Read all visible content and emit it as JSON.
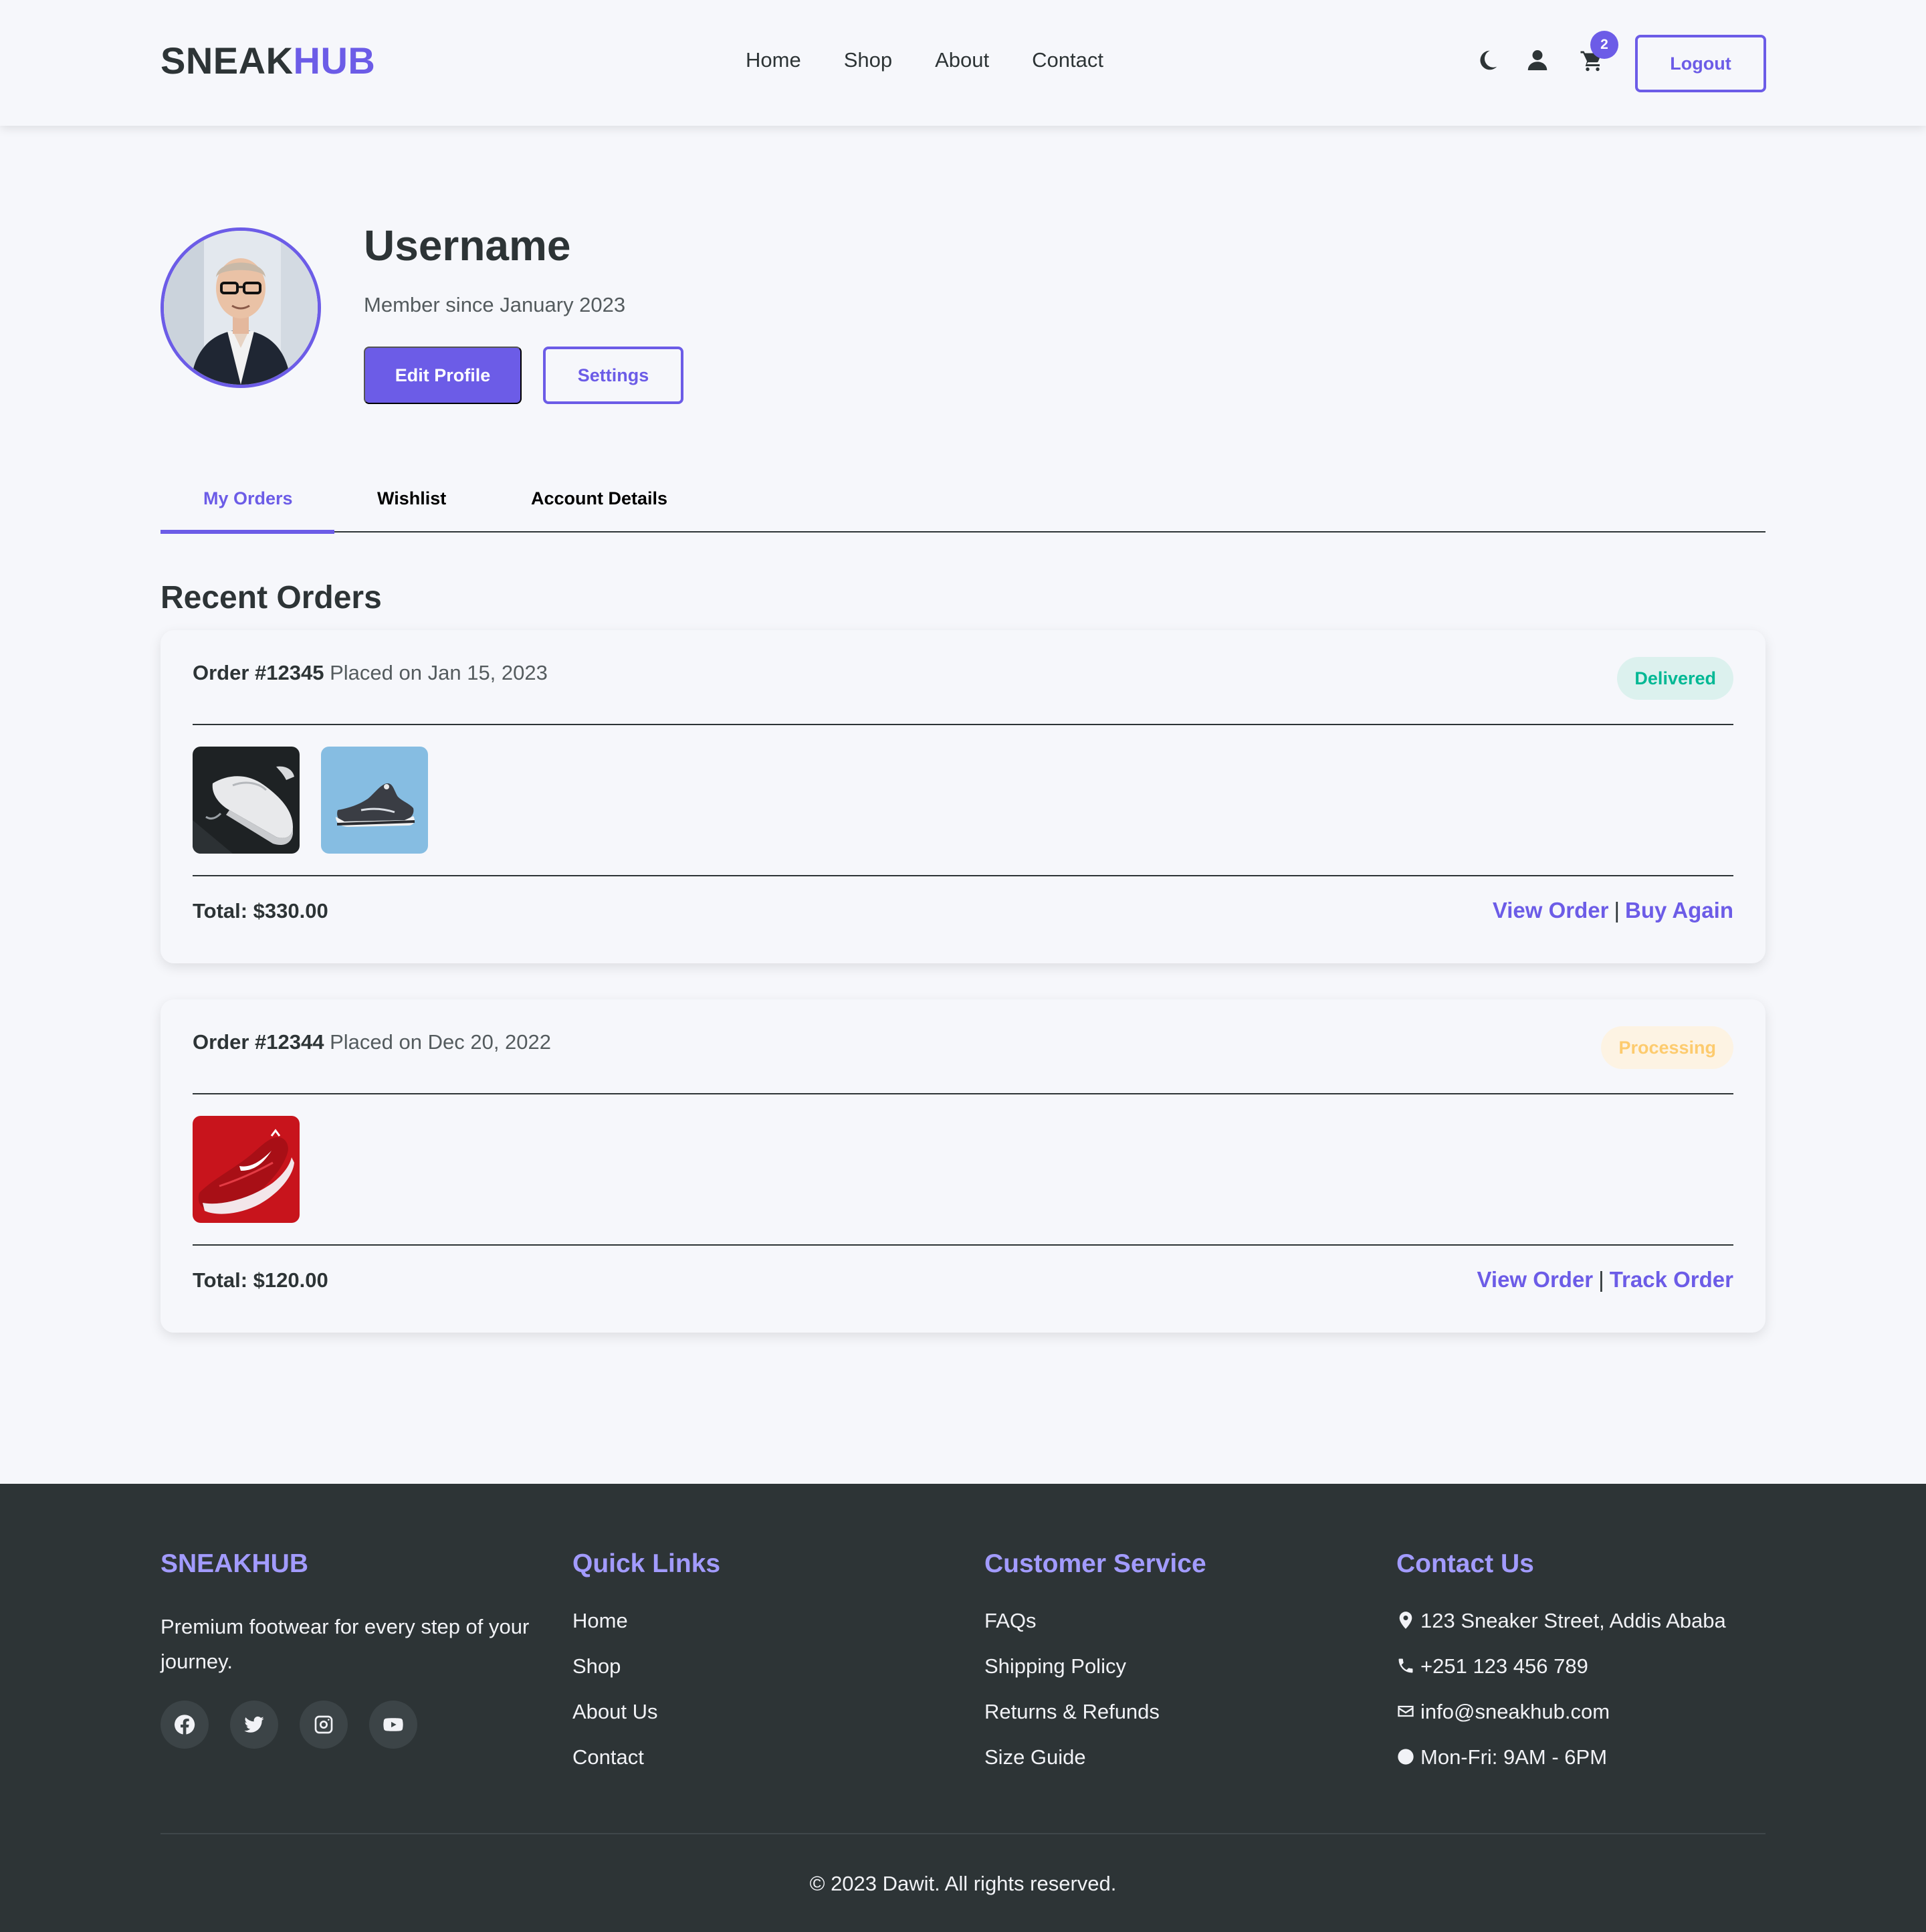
{
  "header": {
    "logo_part1": "SNEAK",
    "logo_part2": "HUB",
    "nav": [
      "Home",
      "Shop",
      "About",
      "Contact"
    ],
    "icons": [
      "moon-icon",
      "user-icon",
      "cart-icon"
    ],
    "cart_count": "2",
    "logout_label": "Logout"
  },
  "profile": {
    "username": "Username",
    "member_since": "Member since January 2023",
    "edit_label": "Edit Profile",
    "settings_label": "Settings"
  },
  "tabs": [
    {
      "label": "My Orders",
      "active": true
    },
    {
      "label": "Wishlist",
      "active": false
    },
    {
      "label": "Account Details",
      "active": false
    }
  ],
  "orders": {
    "title": "Recent Orders",
    "items": [
      {
        "number": "Order #12345",
        "placed": "Placed on Jan 15, 2023",
        "status": "Delivered",
        "total": "Total: $330.00",
        "action1": "View Order",
        "separator": "|",
        "action2": "Buy Again",
        "products": [
          "white-sneaker",
          "black-sneaker-on-blue"
        ]
      },
      {
        "number": "Order #12344",
        "placed": "Placed on Dec 20, 2022",
        "status": "Processing",
        "total": "Total: $120.00",
        "action1": "View Order",
        "separator": "|",
        "action2": "Track Order",
        "products": [
          "red-sneaker"
        ]
      }
    ]
  },
  "footer": {
    "brand": "SNEAKHUB",
    "tagline": "Premium footwear for every step of your journey.",
    "social_icons": [
      "facebook-icon",
      "twitter-icon",
      "instagram-icon",
      "youtube-icon"
    ],
    "quick_links": {
      "title": "Quick Links",
      "items": [
        "Home",
        "Shop",
        "About Us",
        "Contact"
      ]
    },
    "customer_service": {
      "title": "Customer Service",
      "items": [
        "FAQs",
        "Shipping Policy",
        "Returns & Refunds",
        "Size Guide"
      ]
    },
    "contact": {
      "title": "Contact Us",
      "items": [
        "123 Sneaker Street, Addis Ababa",
        "+251 123 456 789",
        "info@sneakhub.com",
        "Mon-Fri: 9AM - 6PM"
      ]
    },
    "copyright": "© 2023 Dawit. All rights reserved."
  },
  "colors": {
    "accent": "#6c5ce7",
    "accent_light": "#a29bfe",
    "text_dark": "#2d3436",
    "background": "#f6f7fb",
    "footer_bg": "#2d3436",
    "delivered": "#00b894",
    "processing": "#fdcb6e"
  }
}
